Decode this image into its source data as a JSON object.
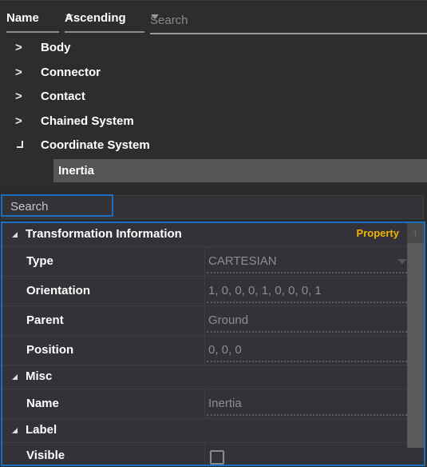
{
  "toolbar": {
    "sort_field": "Name",
    "sort_order": "Ascending",
    "search_placeholder": "Search"
  },
  "tree": {
    "items": [
      {
        "label": "Body",
        "expander": ">"
      },
      {
        "label": "Connector",
        "expander": ">"
      },
      {
        "label": "Contact",
        "expander": ">"
      },
      {
        "label": "Chained System",
        "expander": ">"
      },
      {
        "label": "Coordinate System",
        "expander": "expanded"
      }
    ],
    "selected_child": "Inertia"
  },
  "property_grid": {
    "search_placeholder": "Search",
    "header_tag": "Property",
    "categories": [
      {
        "title": "Transformation Information",
        "properties": [
          {
            "name": "Type",
            "value": "CARTESIAN"
          },
          {
            "name": "Orientation",
            "value": "1, 0, 0, 0, 1, 0, 0, 0, 1"
          },
          {
            "name": "Parent",
            "value": "Ground"
          },
          {
            "name": "Position",
            "value": "0, 0, 0"
          }
        ]
      },
      {
        "title": "Misc",
        "properties": [
          {
            "name": "Name",
            "value": "Inertia"
          }
        ]
      },
      {
        "title": "Label",
        "properties": [
          {
            "name": "Visible",
            "value": "",
            "checked": false
          }
        ]
      }
    ]
  },
  "colors": {
    "accent": "#1c6fc0",
    "property_tag": "#f0b400",
    "selection": "#555555"
  }
}
